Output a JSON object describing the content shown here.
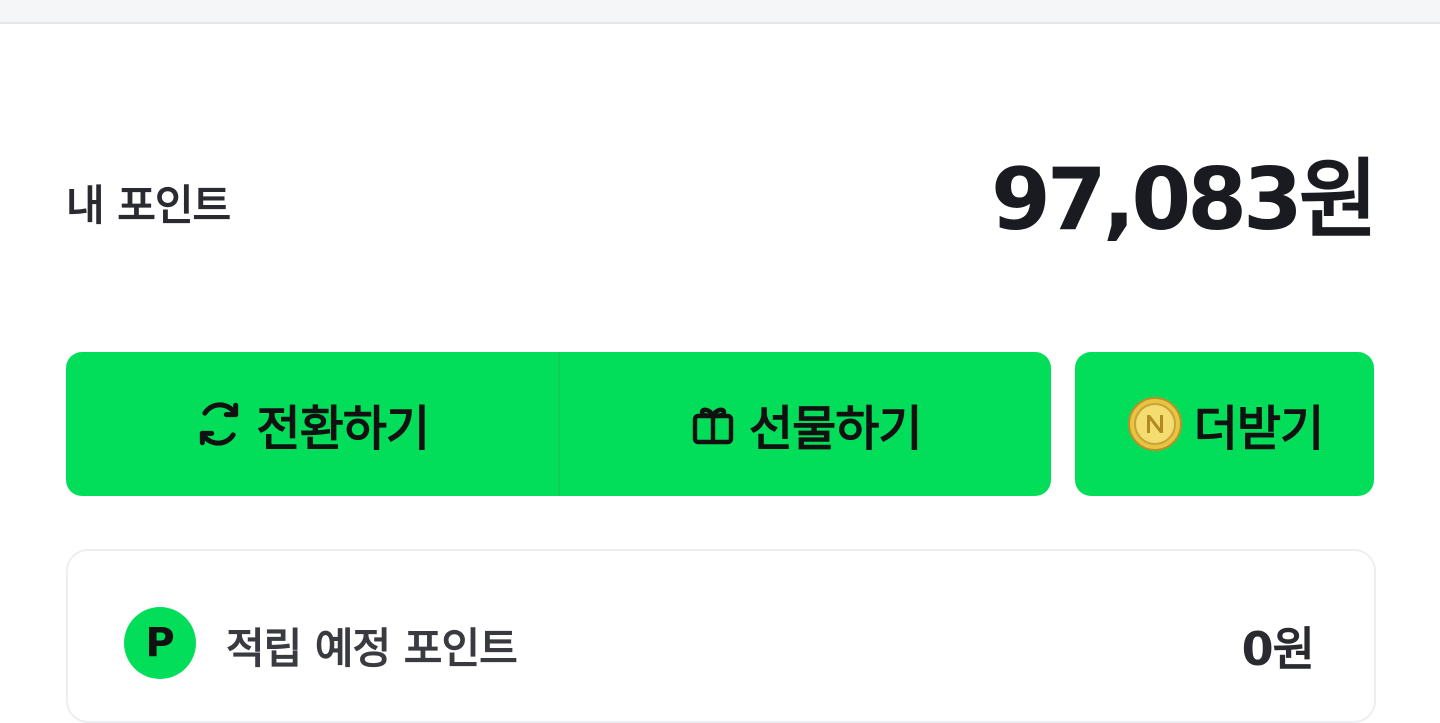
{
  "points": {
    "label": "내 포인트",
    "value": "97,083원"
  },
  "actions": {
    "convert_label": "전환하기",
    "convert_icon": "refresh-icon",
    "gift_label": "선물하기",
    "gift_icon": "gift-icon",
    "more_label": "더받기",
    "more_icon": "coin-icon"
  },
  "pending": {
    "badge": "P",
    "label": "적립 예정 포인트",
    "value": "0원"
  },
  "colors": {
    "accent": "#03de5a",
    "text": "#1d1d22"
  }
}
